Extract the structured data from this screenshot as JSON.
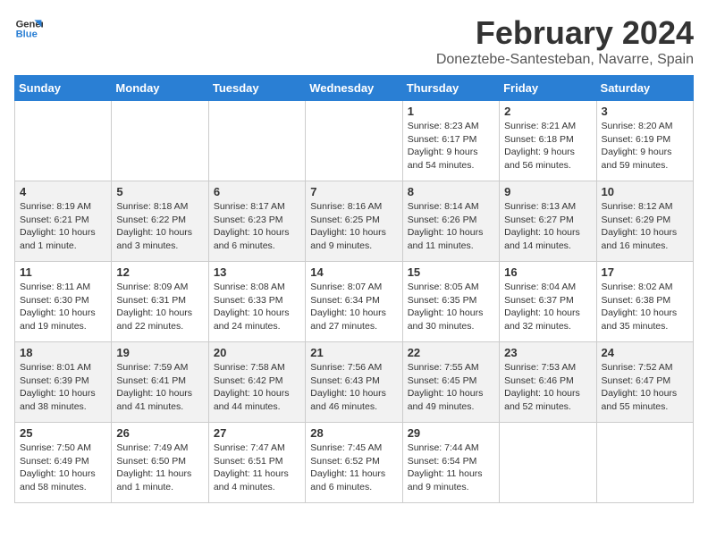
{
  "logo": {
    "line1": "General",
    "line2": "Blue"
  },
  "title": "February 2024",
  "subtitle": "Doneztebe-Santesteban, Navarre, Spain",
  "days_of_week": [
    "Sunday",
    "Monday",
    "Tuesday",
    "Wednesday",
    "Thursday",
    "Friday",
    "Saturday"
  ],
  "weeks": [
    [
      {
        "day": "",
        "info": ""
      },
      {
        "day": "",
        "info": ""
      },
      {
        "day": "",
        "info": ""
      },
      {
        "day": "",
        "info": ""
      },
      {
        "day": "1",
        "info": "Sunrise: 8:23 AM\nSunset: 6:17 PM\nDaylight: 9 hours\nand 54 minutes."
      },
      {
        "day": "2",
        "info": "Sunrise: 8:21 AM\nSunset: 6:18 PM\nDaylight: 9 hours\nand 56 minutes."
      },
      {
        "day": "3",
        "info": "Sunrise: 8:20 AM\nSunset: 6:19 PM\nDaylight: 9 hours\nand 59 minutes."
      }
    ],
    [
      {
        "day": "4",
        "info": "Sunrise: 8:19 AM\nSunset: 6:21 PM\nDaylight: 10 hours\nand 1 minute."
      },
      {
        "day": "5",
        "info": "Sunrise: 8:18 AM\nSunset: 6:22 PM\nDaylight: 10 hours\nand 3 minutes."
      },
      {
        "day": "6",
        "info": "Sunrise: 8:17 AM\nSunset: 6:23 PM\nDaylight: 10 hours\nand 6 minutes."
      },
      {
        "day": "7",
        "info": "Sunrise: 8:16 AM\nSunset: 6:25 PM\nDaylight: 10 hours\nand 9 minutes."
      },
      {
        "day": "8",
        "info": "Sunrise: 8:14 AM\nSunset: 6:26 PM\nDaylight: 10 hours\nand 11 minutes."
      },
      {
        "day": "9",
        "info": "Sunrise: 8:13 AM\nSunset: 6:27 PM\nDaylight: 10 hours\nand 14 minutes."
      },
      {
        "day": "10",
        "info": "Sunrise: 8:12 AM\nSunset: 6:29 PM\nDaylight: 10 hours\nand 16 minutes."
      }
    ],
    [
      {
        "day": "11",
        "info": "Sunrise: 8:11 AM\nSunset: 6:30 PM\nDaylight: 10 hours\nand 19 minutes."
      },
      {
        "day": "12",
        "info": "Sunrise: 8:09 AM\nSunset: 6:31 PM\nDaylight: 10 hours\nand 22 minutes."
      },
      {
        "day": "13",
        "info": "Sunrise: 8:08 AM\nSunset: 6:33 PM\nDaylight: 10 hours\nand 24 minutes."
      },
      {
        "day": "14",
        "info": "Sunrise: 8:07 AM\nSunset: 6:34 PM\nDaylight: 10 hours\nand 27 minutes."
      },
      {
        "day": "15",
        "info": "Sunrise: 8:05 AM\nSunset: 6:35 PM\nDaylight: 10 hours\nand 30 minutes."
      },
      {
        "day": "16",
        "info": "Sunrise: 8:04 AM\nSunset: 6:37 PM\nDaylight: 10 hours\nand 32 minutes."
      },
      {
        "day": "17",
        "info": "Sunrise: 8:02 AM\nSunset: 6:38 PM\nDaylight: 10 hours\nand 35 minutes."
      }
    ],
    [
      {
        "day": "18",
        "info": "Sunrise: 8:01 AM\nSunset: 6:39 PM\nDaylight: 10 hours\nand 38 minutes."
      },
      {
        "day": "19",
        "info": "Sunrise: 7:59 AM\nSunset: 6:41 PM\nDaylight: 10 hours\nand 41 minutes."
      },
      {
        "day": "20",
        "info": "Sunrise: 7:58 AM\nSunset: 6:42 PM\nDaylight: 10 hours\nand 44 minutes."
      },
      {
        "day": "21",
        "info": "Sunrise: 7:56 AM\nSunset: 6:43 PM\nDaylight: 10 hours\nand 46 minutes."
      },
      {
        "day": "22",
        "info": "Sunrise: 7:55 AM\nSunset: 6:45 PM\nDaylight: 10 hours\nand 49 minutes."
      },
      {
        "day": "23",
        "info": "Sunrise: 7:53 AM\nSunset: 6:46 PM\nDaylight: 10 hours\nand 52 minutes."
      },
      {
        "day": "24",
        "info": "Sunrise: 7:52 AM\nSunset: 6:47 PM\nDaylight: 10 hours\nand 55 minutes."
      }
    ],
    [
      {
        "day": "25",
        "info": "Sunrise: 7:50 AM\nSunset: 6:49 PM\nDaylight: 10 hours\nand 58 minutes."
      },
      {
        "day": "26",
        "info": "Sunrise: 7:49 AM\nSunset: 6:50 PM\nDaylight: 11 hours\nand 1 minute."
      },
      {
        "day": "27",
        "info": "Sunrise: 7:47 AM\nSunset: 6:51 PM\nDaylight: 11 hours\nand 4 minutes."
      },
      {
        "day": "28",
        "info": "Sunrise: 7:45 AM\nSunset: 6:52 PM\nDaylight: 11 hours\nand 6 minutes."
      },
      {
        "day": "29",
        "info": "Sunrise: 7:44 AM\nSunset: 6:54 PM\nDaylight: 11 hours\nand 9 minutes."
      },
      {
        "day": "",
        "info": ""
      },
      {
        "day": "",
        "info": ""
      }
    ]
  ]
}
